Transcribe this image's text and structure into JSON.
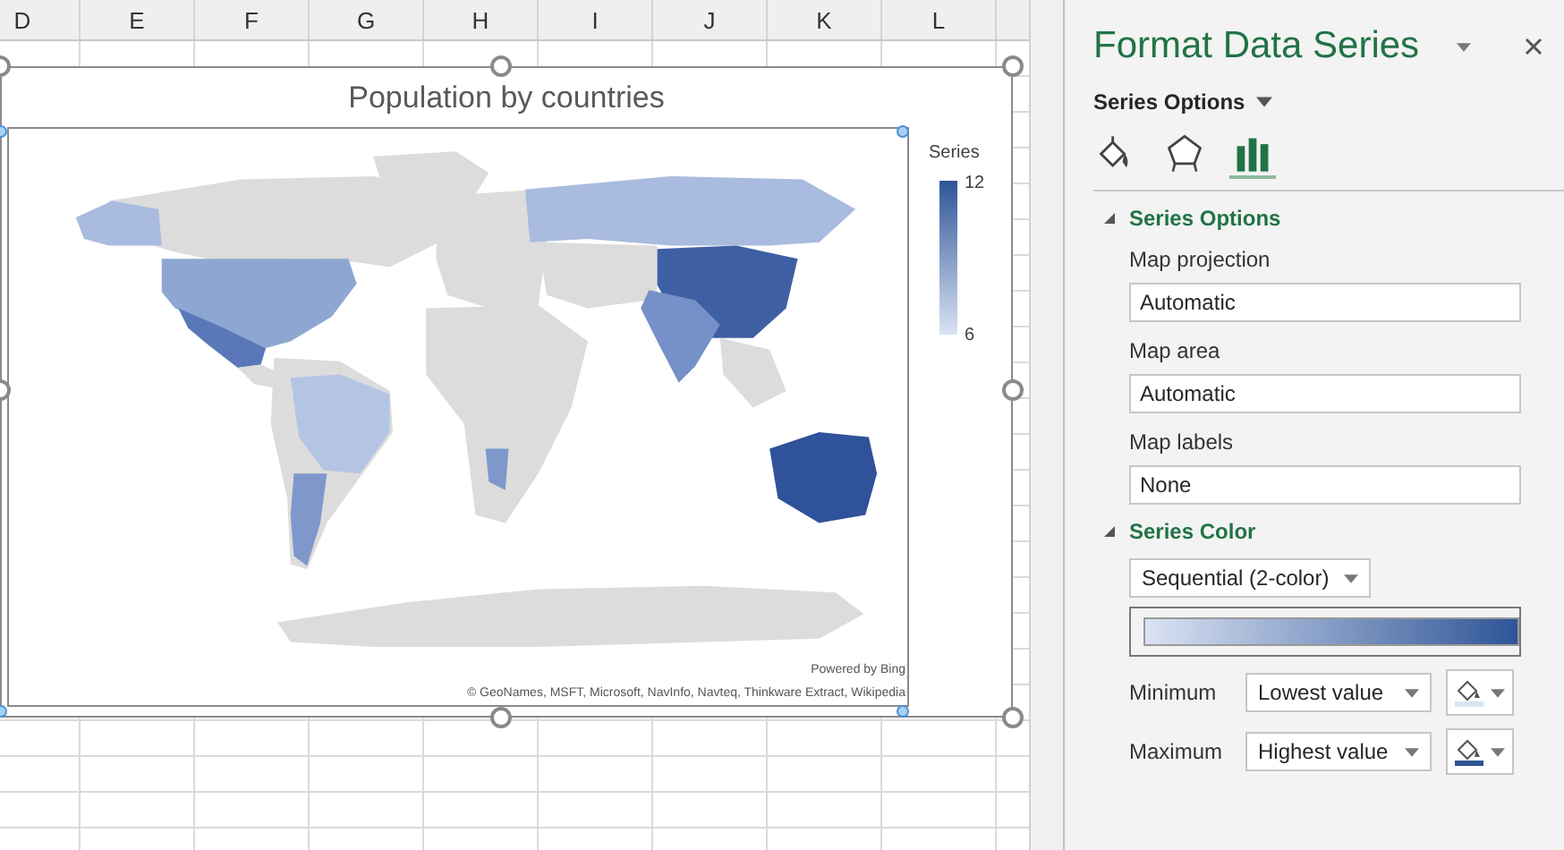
{
  "sheet": {
    "columns": [
      "D",
      "E",
      "F",
      "G",
      "H",
      "I",
      "J",
      "K",
      "L"
    ]
  },
  "chart": {
    "title": "Population by countries",
    "legend": {
      "title": "Series",
      "max": "12",
      "min": "6"
    },
    "credit": "Powered by Bing",
    "attribution": "© GeoNames, MSFT, Microsoft, NavInfo, Navteq, Thinkware Extract, Wikipedia"
  },
  "panel": {
    "title": "Format Data Series",
    "options_menu": "Series Options",
    "tabs": [
      {
        "kind": "fill",
        "selected": false
      },
      {
        "kind": "effects",
        "selected": false
      },
      {
        "kind": "series",
        "selected": true
      }
    ],
    "series_options": {
      "title": "Series Options",
      "expanded": true,
      "fields": [
        {
          "label": "Map projection",
          "value": "Automatic"
        },
        {
          "label": "Map area",
          "value": "Automatic"
        },
        {
          "label": "Map labels",
          "value": "None"
        }
      ]
    },
    "series_color": {
      "title": "Series Color",
      "expanded": true,
      "scheme": "Sequential (2-color)",
      "stops": [
        {
          "label": "Minimum",
          "value": "Lowest value",
          "color": "#dae3f3"
        },
        {
          "label": "Maximum",
          "value": "Highest value",
          "color": "#2f5597"
        }
      ]
    }
  }
}
